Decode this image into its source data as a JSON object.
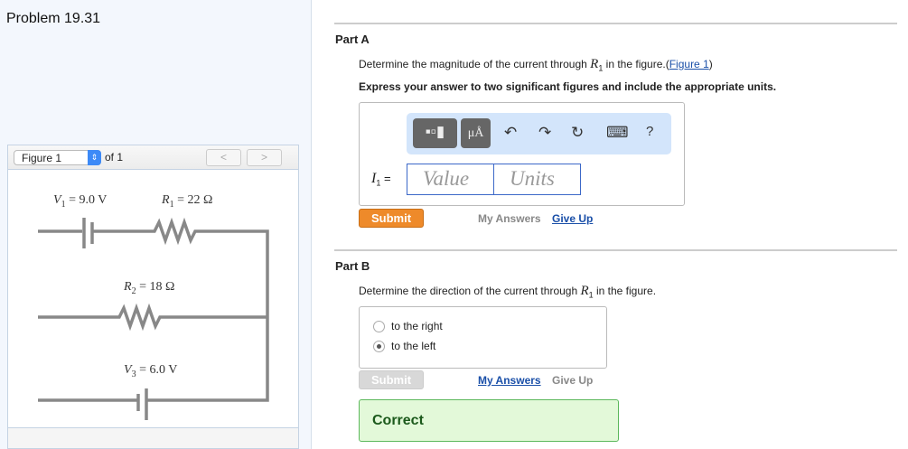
{
  "problem_title": "Problem 19.31",
  "figure": {
    "select_value": "Figure 1",
    "of_label": "of 1",
    "prev": "<",
    "next": ">",
    "labels": {
      "v1": "V",
      "v1_sub": "1",
      "v1_val": " = 9.0 V",
      "r1": "R",
      "r1_sub": "1",
      "r1_val": " = 22 Ω",
      "r2": "R",
      "r2_sub": "2",
      "r2_val": " = 18 Ω",
      "v3": "V",
      "v3_sub": "3",
      "v3_val": " = 6.0 V"
    }
  },
  "part_a": {
    "title": "Part A",
    "question_pre": "Determine the magnitude of the current through ",
    "question_var": "R",
    "question_sub": "1",
    "question_post": " in the figure.(",
    "figure_link": "Figure 1",
    "question_end": ")",
    "instruction": "Express your answer to two significant figures and include the appropriate units.",
    "toolbar": {
      "units_button": "μÅ",
      "undo": "↶",
      "redo": "↷",
      "reset": "↻",
      "keyboard": "⌨",
      "help": "?"
    },
    "var_label": "I",
    "var_sub": "1",
    "equals": "=",
    "value_placeholder": "Value",
    "units_placeholder": "Units",
    "submit": "Submit",
    "my_answers": "My Answers",
    "give_up": "Give Up"
  },
  "part_b": {
    "title": "Part B",
    "question_pre": "Determine the direction of the current through ",
    "question_var": "R",
    "question_sub": "1",
    "question_post": " in the figure.",
    "options": [
      {
        "label": "to the right",
        "selected": false
      },
      {
        "label": "to the left",
        "selected": true
      }
    ],
    "submit": "Submit",
    "my_answers": "My Answers",
    "give_up": "Give Up",
    "result": "Correct"
  }
}
